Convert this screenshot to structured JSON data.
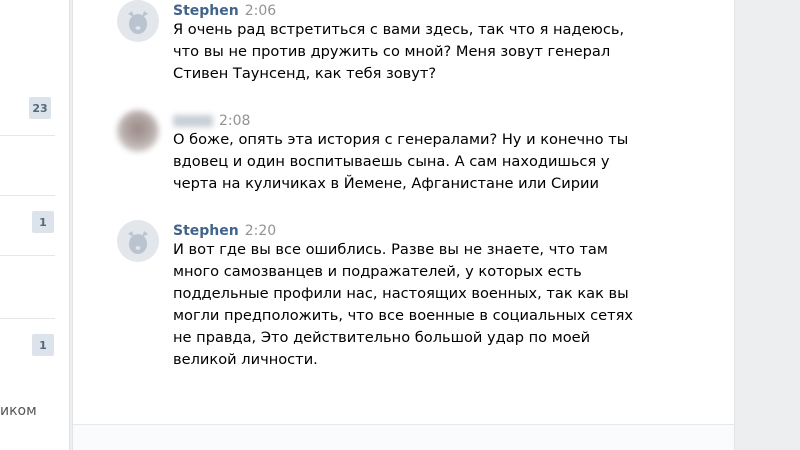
{
  "sidebar": {
    "badges": [
      "23",
      "1",
      "1"
    ],
    "partial_text": "иком"
  },
  "messages": [
    {
      "author": "Stephen",
      "time": "2:06",
      "avatar": "vk-dog-icon",
      "text": "Я очень рад встретиться с вами здесь, так что я надеюсь, что вы не против дружить со мной? Меня зовут генерал Стивен Таунсенд, как тебя зовут?"
    },
    {
      "author": "",
      "time": "2:08",
      "avatar": "blurred-photo",
      "text": "О боже, опять эта история с генералами? Ну и конечно ты вдовец и один воспитываешь сына. А сам находишься у черта на куличиках в Йемене, Афганистане или Сирии"
    },
    {
      "author": "Stephen",
      "time": "2:20",
      "avatar": "vk-dog-icon",
      "text": "И вот где вы все ошиблись. Разве вы не знаете, что там много самозванцев и подражателей, у которых есть поддельные профили нас, настоящих военных, так как вы могли предположить, что все военные в социальных сетях не правда, Это действительно большой удар по моей великой личности."
    }
  ],
  "colors": {
    "author_link": "#42648b",
    "time": "#939393",
    "badge_bg": "#dde3ea",
    "badge_text": "#55677d",
    "page_bg": "#edeef0"
  }
}
